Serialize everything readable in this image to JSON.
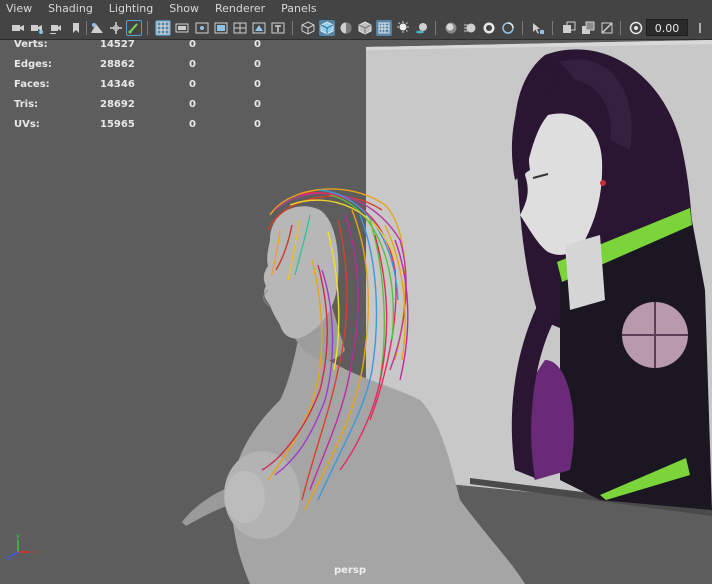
{
  "menubar": {
    "items": [
      {
        "label": "View"
      },
      {
        "label": "Shading"
      },
      {
        "label": "Lighting"
      },
      {
        "label": "Show"
      },
      {
        "label": "Renderer"
      },
      {
        "label": "Panels"
      }
    ]
  },
  "toolbar": {
    "camera_zoom": "0.00",
    "active_tools": [
      "paint-tool",
      "wireframe-on-shaded",
      "xray-mode"
    ]
  },
  "hud": {
    "rows": [
      {
        "label": "Verts:",
        "v1": "14527",
        "v2": "0",
        "v3": "0"
      },
      {
        "label": "Edges:",
        "v1": "28862",
        "v2": "0",
        "v3": "0"
      },
      {
        "label": "Faces:",
        "v1": "14346",
        "v2": "0",
        "v3": "0"
      },
      {
        "label": "Tris:",
        "v1": "28692",
        "v2": "0",
        "v3": "0"
      },
      {
        "label": "UVs:",
        "v1": "15965",
        "v2": "0",
        "v3": "0"
      }
    ]
  },
  "viewport": {
    "camera_name": "persp",
    "axis_labels": {
      "x": "x",
      "y": "y",
      "z": "z"
    }
  },
  "colors": {
    "menubar_bg": "#444444",
    "viewport_bg": "#5d5d5d",
    "accent_active": "#5285a6",
    "axis_x": "#e03030",
    "axis_y": "#30d030",
    "axis_z": "#3060ff"
  }
}
